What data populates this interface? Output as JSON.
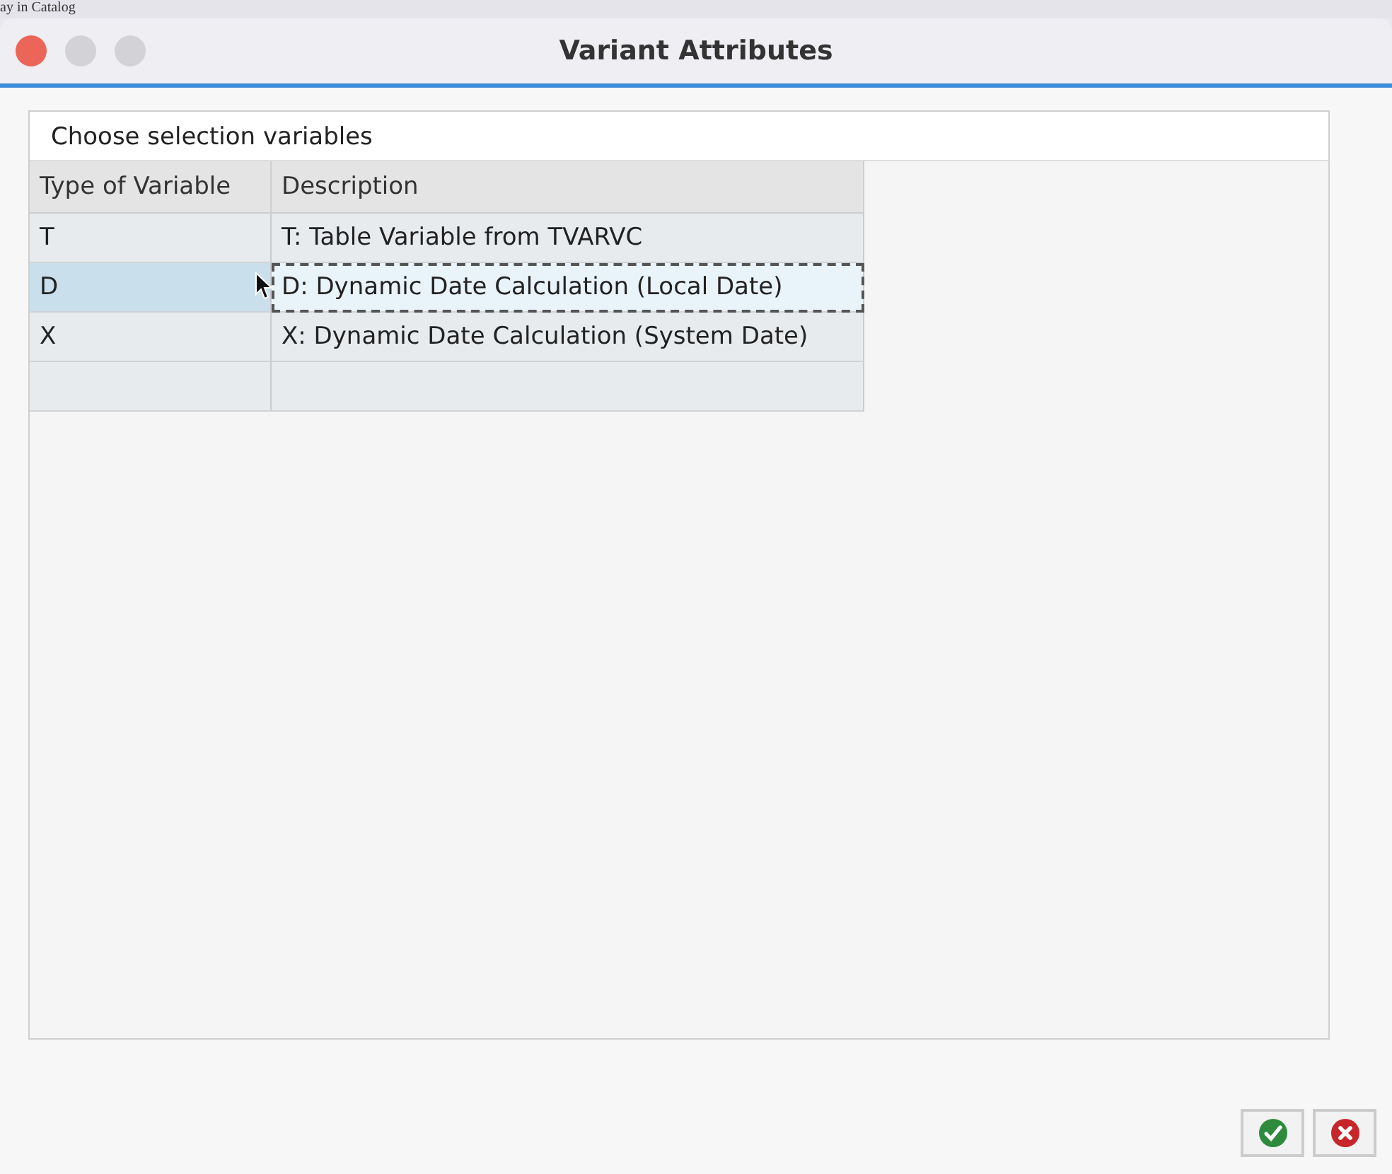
{
  "background_window": {
    "title": "ay in Catalog"
  },
  "window": {
    "title": "Variant Attributes"
  },
  "panel": {
    "title": "Choose selection variables"
  },
  "table": {
    "columns": [
      "Type of Variable",
      "Description"
    ],
    "rows": [
      {
        "type": "T",
        "description": "T: Table Variable from TVARVC",
        "selected": false
      },
      {
        "type": "D",
        "description": "D: Dynamic Date Calculation (Local Date)",
        "selected": true
      },
      {
        "type": "X",
        "description": "X: Dynamic Date Calculation (System Date)",
        "selected": false
      }
    ]
  },
  "buttons": [
    {
      "kind": "confirm"
    },
    {
      "kind": "cancel"
    }
  ]
}
